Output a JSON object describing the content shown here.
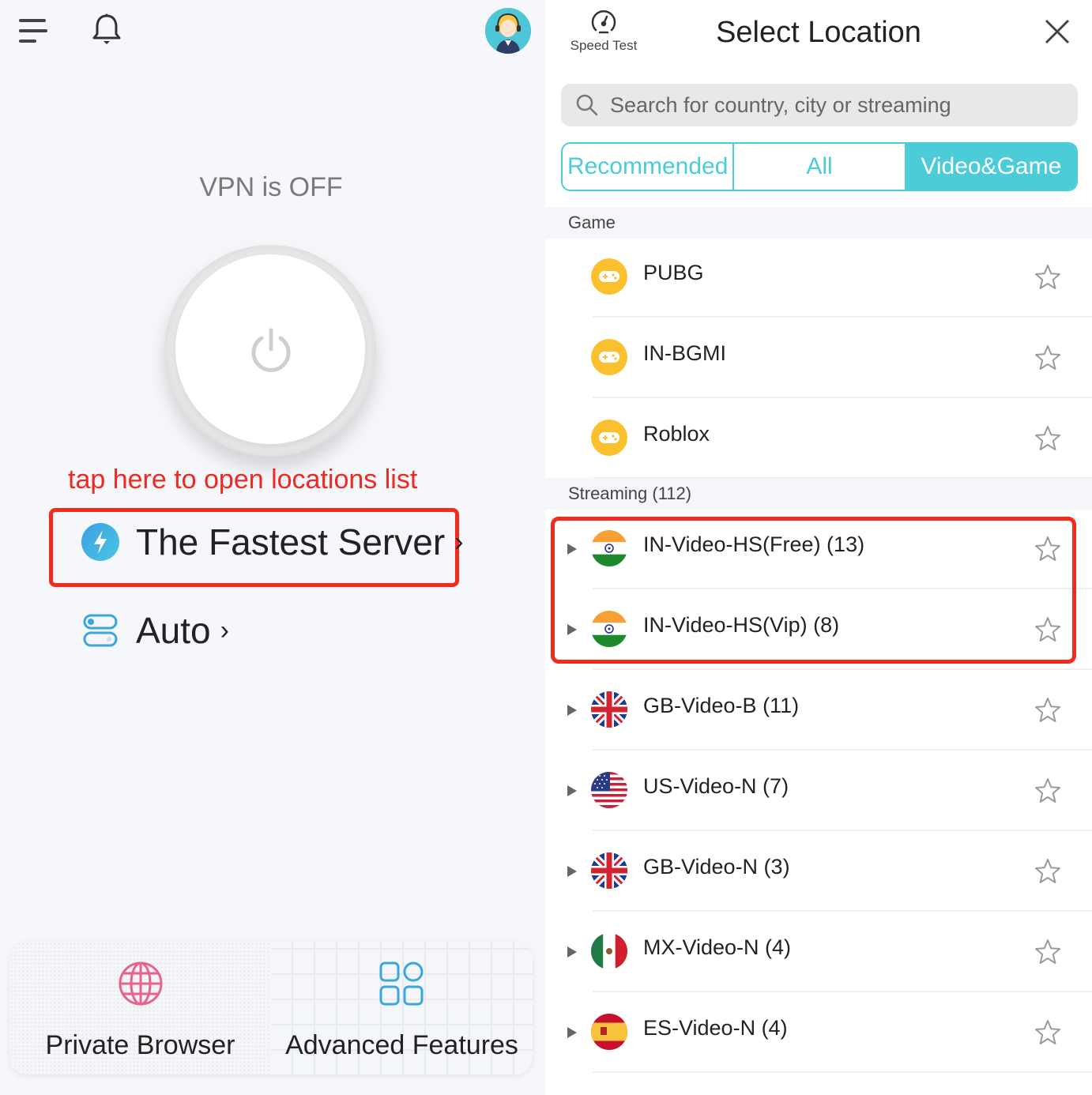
{
  "home": {
    "vpn_status": "VPN is OFF",
    "hint_text": "tap here to open locations list",
    "fastest_server_label": "The Fastest Server",
    "auto_label": "Auto",
    "chevron": "›",
    "bottom": {
      "private_browser_label": "Private Browser",
      "advanced_features_label": "Advanced Features"
    }
  },
  "location_panel": {
    "speed_test_label": "Speed Test",
    "title": "Select Location",
    "search_placeholder": "Search for country, city or streaming",
    "tabs": [
      {
        "label": "Recommended",
        "active": false
      },
      {
        "label": "All",
        "active": false
      },
      {
        "label": "Video&Game",
        "active": true
      }
    ],
    "sections": {
      "game": {
        "header": "Game",
        "items": [
          {
            "name": "PUBG",
            "icon": "gamepad-icon"
          },
          {
            "name": "IN-BGMI",
            "icon": "gamepad-icon"
          },
          {
            "name": "Roblox",
            "icon": "gamepad-icon"
          }
        ]
      },
      "streaming": {
        "header": "Streaming (112)",
        "items": [
          {
            "name": "IN-Video-HS(Free) (13)",
            "flag": "india-flag-icon"
          },
          {
            "name": "IN-Video-HS(Vip) (8)",
            "flag": "india-flag-icon"
          },
          {
            "name": "GB-Video-B (11)",
            "flag": "uk-flag-icon"
          },
          {
            "name": "US-Video-N (7)",
            "flag": "us-flag-icon"
          },
          {
            "name": "GB-Video-N (3)",
            "flag": "uk-flag-icon"
          },
          {
            "name": "MX-Video-N (4)",
            "flag": "mexico-flag-icon"
          },
          {
            "name": "ES-Video-N (4)",
            "flag": "spain-flag-icon"
          }
        ]
      }
    }
  },
  "colors": {
    "accent": "#4ccbd9",
    "annotation_red": "#f22c1c",
    "game_icon": "#fbc02d"
  }
}
